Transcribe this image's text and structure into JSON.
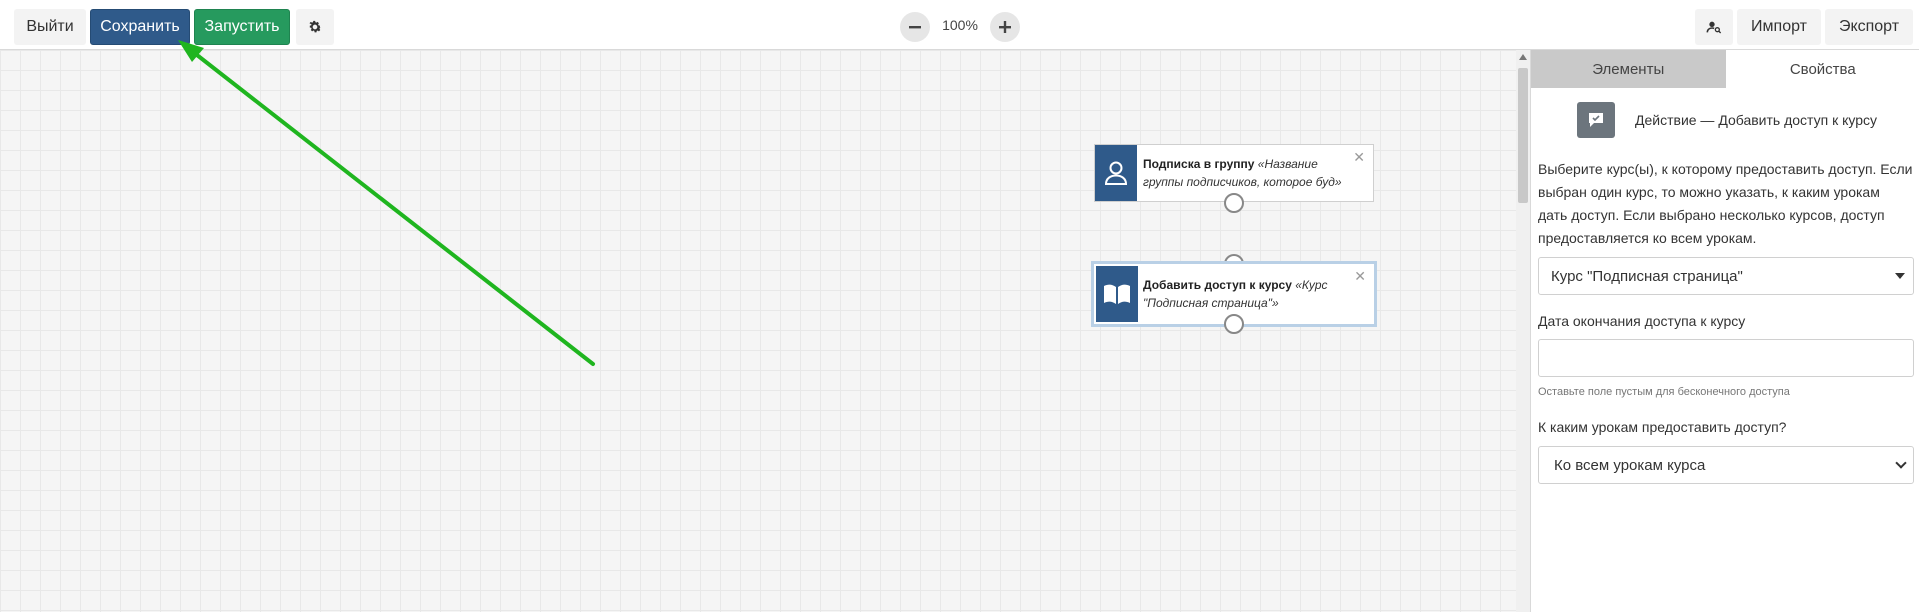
{
  "toolbar": {
    "exit_label": "Выйти",
    "save_label": "Сохранить",
    "run_label": "Запустить",
    "zoom_level": "100%",
    "import_label": "Импорт",
    "export_label": "Экспорт",
    "icons": {
      "settings": "gear-icon",
      "zoom_out": "minus-icon",
      "zoom_in": "plus-icon",
      "find": "user-search-icon"
    }
  },
  "canvas": {
    "nodes": [
      {
        "title": "Подписка в группу",
        "detail": "«Название группы подписчиков, которое буд»",
        "icon": "user-icon",
        "selected": false
      },
      {
        "title": "Добавить доступ к курсу",
        "detail": "«Курс \"Подписная страница\"»",
        "icon": "book-icon",
        "selected": true
      }
    ]
  },
  "panel": {
    "tabs": [
      "Элементы",
      "Свойства"
    ],
    "active_tab": "Свойства",
    "action_title": "Действие — Добавить доступ к курсу",
    "description": "Выберите курс(ы), к которому предоставить доступ. Если выбран один курс, то можно указать, к каким урокам дать доступ. Если выбрано несколько курсов, доступ предоставляется ко всем урокам.",
    "course_select_value": "Курс \"Подписная страница\"",
    "date_label": "Дата окончания доступа к курсу",
    "date_value": "",
    "date_hint": "Оставьте поле пустым для бесконечного доступа",
    "lessons_label": "К каким урокам предоставить доступ?",
    "lessons_select_value": "Ко всем урокам курса"
  },
  "colors": {
    "save_button": "#2f5a8a",
    "run_button": "#269a5e",
    "node_icon_bg": "#2f5a8a",
    "annotation_arrow": "#1fb51f"
  }
}
